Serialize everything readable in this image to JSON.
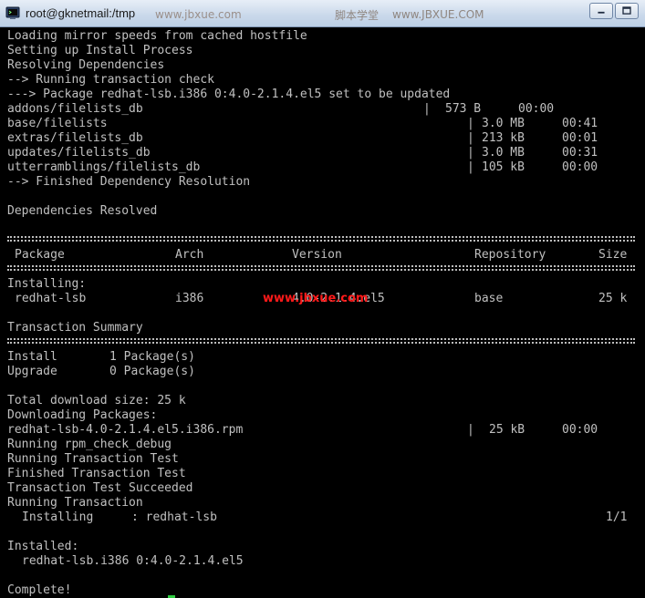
{
  "window": {
    "title": "root@gknetmail:/tmp",
    "watermark_url": "www.jbxue.com",
    "watermark_site": "脚本学堂",
    "watermark_url_upper": "www.JBXUE.COM"
  },
  "terminal": {
    "line_loading": "Loading mirror speeds from cached hostfile",
    "line_setting": "Setting up Install Process",
    "line_resolving": "Resolving Dependencies",
    "line_running_check": "--> Running transaction check",
    "line_package_update": "---> Package redhat-lsb.i386 0:4.0-2.1.4.el5 set to be updated",
    "filelists": [
      {
        "name": "addons/filelists_db",
        "size": "573 B",
        "time": "00:00"
      },
      {
        "name": "base/filelists",
        "size": "3.0 MB",
        "time": "00:41"
      },
      {
        "name": "extras/filelists_db",
        "size": "213 kB",
        "time": "00:01"
      },
      {
        "name": "updates/filelists_db",
        "size": "3.0 MB",
        "time": "00:31"
      },
      {
        "name": "utterramblings/filelists_db",
        "size": "105 kB",
        "time": "00:00"
      }
    ],
    "line_finished_dep": "--> Finished Dependency Resolution",
    "line_deps_resolved": "Dependencies Resolved",
    "table_headers": {
      "package": "Package",
      "arch": "Arch",
      "version": "Version",
      "repository": "Repository",
      "size": "Size"
    },
    "line_installing": "Installing:",
    "install_row": {
      "package": "redhat-lsb",
      "arch": "i386",
      "version": "4.0-2.1.4.el5",
      "repository": "base",
      "size": "25 k"
    },
    "line_tx_summary": "Transaction Summary",
    "summary_install_label": "Install",
    "summary_install_value": "1 Package(s)",
    "summary_upgrade_label": "Upgrade",
    "summary_upgrade_value": "0 Package(s)",
    "line_total_size": "Total download size: 25 k",
    "line_downloading": "Downloading Packages:",
    "download_file": "redhat-lsb-4.0-2.1.4.el5.i386.rpm",
    "download_size": "25 kB",
    "download_time": "00:00",
    "line_rpm_check": "Running rpm_check_debug",
    "line_running_test": "Running Transaction Test",
    "line_finished_test": "Finished Transaction Test",
    "line_test_succeeded": "Transaction Test Succeeded",
    "line_running_tx": "Running Transaction",
    "installing_step_label": "Installing",
    "installing_step_pkg": ": redhat-lsb",
    "installing_step_count": "1/1",
    "line_installed": "Installed:",
    "line_installed_pkg": "redhat-lsb.i386 0:4.0-2.1.4.el5",
    "line_complete": "Complete!"
  },
  "colors": {
    "background": "#000000",
    "text": "#c0c0c0",
    "cursor": "#2ecc40",
    "watermark_red": "#ff1a1a"
  }
}
